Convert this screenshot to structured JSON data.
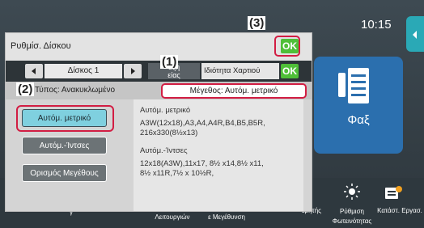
{
  "home": {
    "clock": "10:15",
    "fax_label": "Φαξ",
    "bottom_items": [
      {
        "label": "Λειτουργιών"
      },
      {
        "label": "ε Μεγέθυνση"
      },
      {
        "label": "ερητής"
      },
      {
        "label": "Ρύθμιση Φωτεινότητας"
      },
      {
        "label": "Κατάστ. Εργασ."
      }
    ],
    "bottom_left_char": "γ"
  },
  "dialog": {
    "title": "Ρυθμίσ. Δίσκου",
    "ok_label": "OK",
    "tray_name": "Δίσκος 1",
    "tab_type_label": "αξη\nείας",
    "tab_quality_label": "Ιδιότητα Χαρτιού",
    "tab_ok_label": "OK",
    "type_text": "Τύπος:  Ανακυκλωμένο",
    "size_text": "Μέγεθος: Αυτόμ. μετρικό",
    "options": [
      {
        "label": "Αυτόμ. μετρικό",
        "selected": true
      },
      {
        "label": "Αυτόμ.-Ίντσες",
        "selected": false
      },
      {
        "label": "Ορισμός Μεγέθους",
        "selected": false
      }
    ],
    "detail": {
      "metric_title": "Αυτόμ. μετρικό",
      "metric_line1": "A3W(12x18),A3,A4,A4R,B4,B5,B5R,",
      "metric_line2": "216x330(8½x13)",
      "inch_title": "Αυτόμ.-Ίντσες",
      "inch_line1": "12x18(A3W),11x17, 8½ x14,8½ x11,",
      "inch_line2": "8½ x11R,7½ x 10½R,"
    }
  },
  "callouts": {
    "c1": "(1)",
    "c2": "(2)",
    "c3": "(3)"
  },
  "colors": {
    "highlight": "#d21d43",
    "ok_green": "#4fbf38",
    "selected_option": "#7fd0df",
    "fax_tile": "#2b6fae",
    "menu_teal": "#2aa9b6"
  }
}
